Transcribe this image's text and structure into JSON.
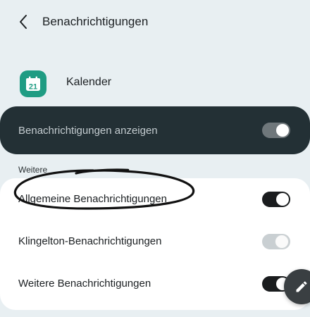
{
  "header": {
    "title": "Benachrichtigungen",
    "back_icon": "chevron-left-icon"
  },
  "app": {
    "name": "Kalender",
    "icon": "calendar-icon",
    "icon_day": "21",
    "icon_color": "#1f9c83"
  },
  "master_toggle": {
    "label": "Benachrichtigungen anzeigen",
    "state": "on",
    "card_color": "#233035"
  },
  "section": {
    "label": "Weitere"
  },
  "items": [
    {
      "label": "Allgemeine Benachrichtigungen",
      "state": "on",
      "enabled": true
    },
    {
      "label": "Klingelton-Benachrichtigungen",
      "state": "on",
      "enabled": false
    },
    {
      "label": "Weitere Benachrichtigungen",
      "state": "on",
      "enabled": true
    }
  ],
  "fab": {
    "icon": "pencil-icon"
  }
}
